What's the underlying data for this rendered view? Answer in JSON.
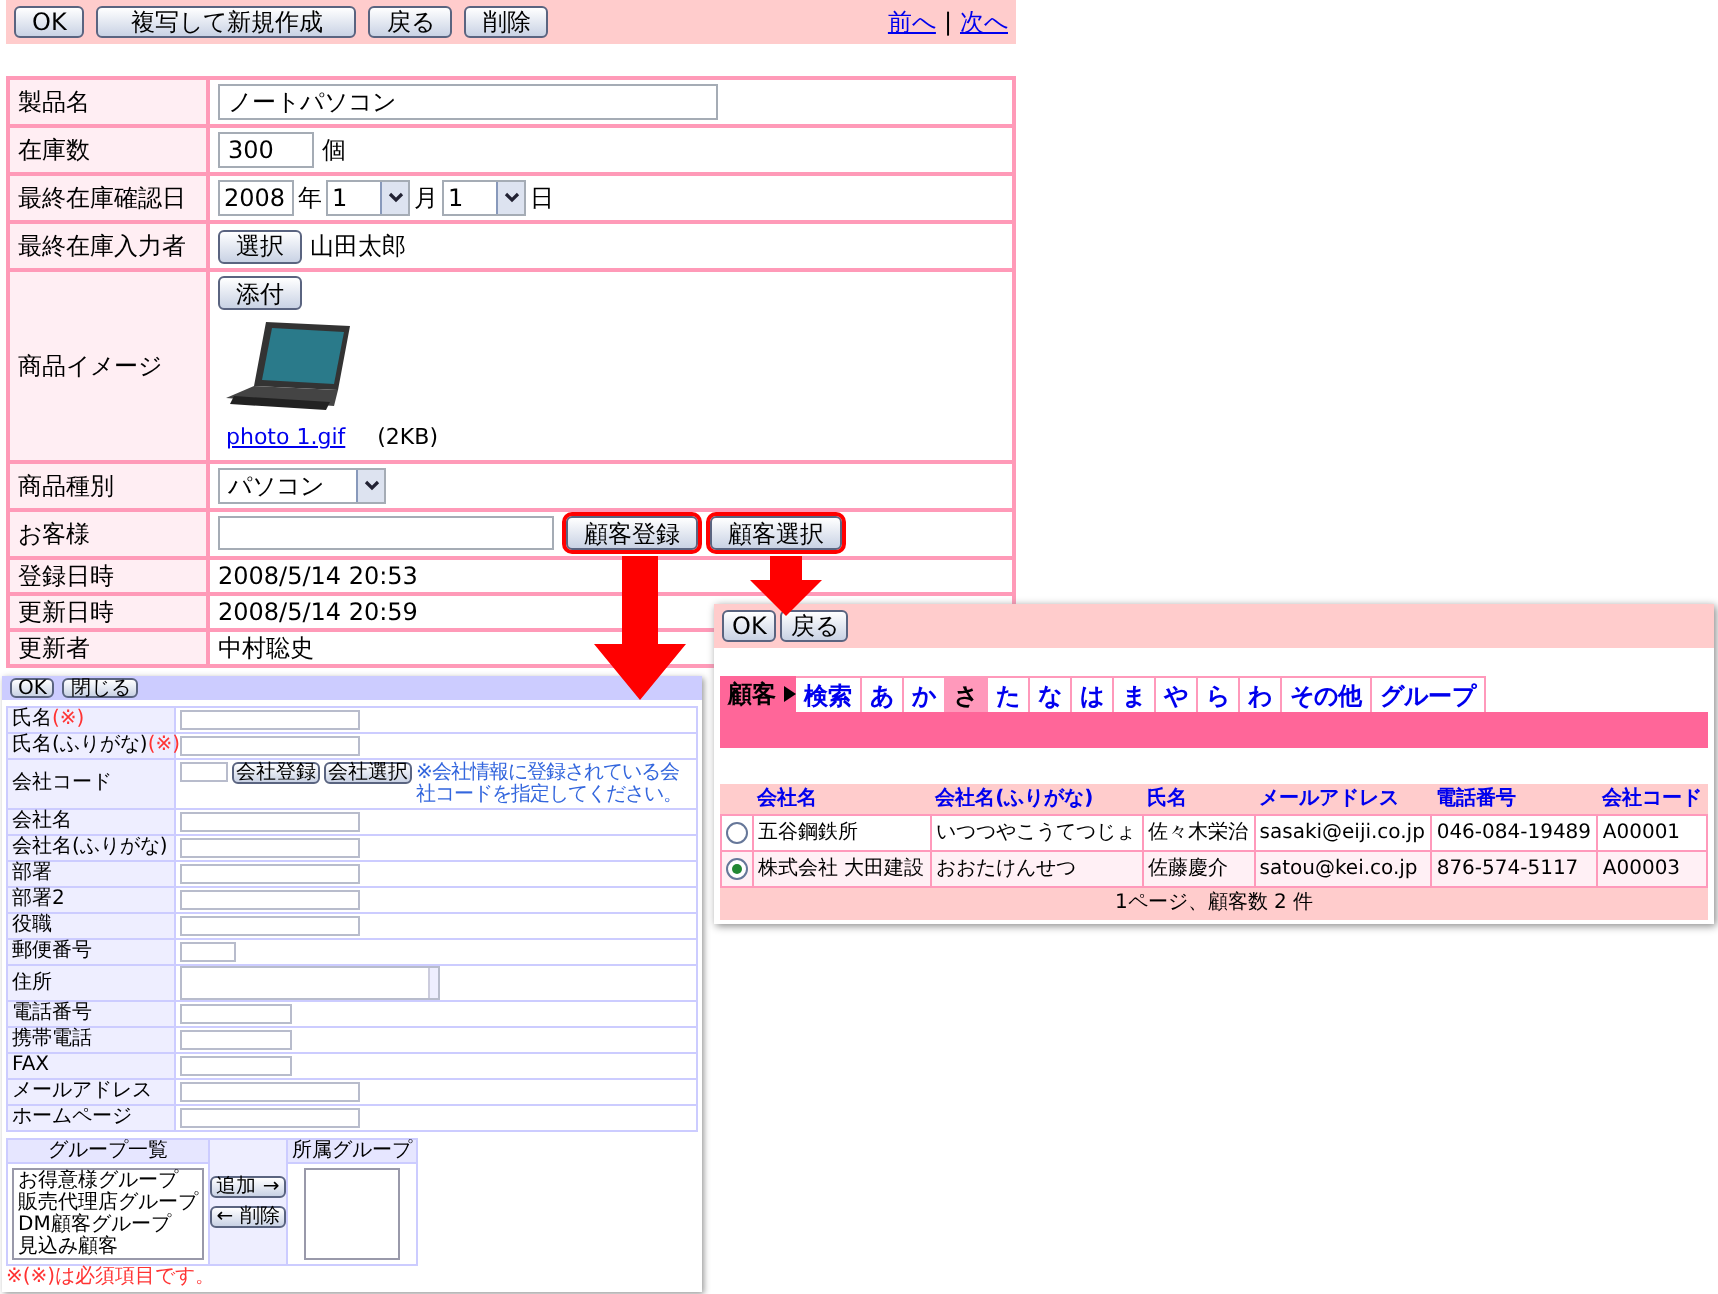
{
  "product_form": {
    "toolbar_buttons": [
      "OK",
      "複写して新規作成",
      "戻る",
      "削除"
    ],
    "nav_links": [
      "前へ",
      "次へ"
    ],
    "nav_separator": "|",
    "rows": [
      {
        "kind": "text",
        "label": "製品名",
        "value": "ノートパソコン"
      },
      {
        "kind": "number",
        "label": "在庫数",
        "value": "300",
        "unit": "個"
      },
      {
        "kind": "date",
        "label": "最終在庫確認日",
        "year": "2008",
        "year_unit": "年",
        "month": "1",
        "month_unit": "月",
        "day": "1",
        "day_unit": "日"
      },
      {
        "kind": "picker",
        "label": "最終在庫入力者",
        "button": "選択",
        "value": "山田太郎"
      },
      {
        "kind": "image",
        "label": "商品イメージ",
        "button": "添付",
        "file_name": "photo 1.gif",
        "file_size": "(2KB)"
      },
      {
        "kind": "select",
        "label": "商品種別",
        "value": "パソコン"
      },
      {
        "kind": "customer",
        "label": "お客様",
        "buttons": [
          {
            "label": "顧客登録",
            "highlighted": true
          },
          {
            "label": "顧客選択",
            "highlighted": true
          }
        ]
      },
      {
        "kind": "static",
        "label": "登録日時",
        "value": "2008/5/14 20:53"
      },
      {
        "kind": "static",
        "label": "更新日時",
        "value": "2008/5/14 20:59"
      },
      {
        "kind": "static",
        "label": "更新者",
        "value": "中村聡史"
      }
    ]
  },
  "customer_register_form": {
    "toolbar_buttons": [
      "OK",
      "閉じる"
    ],
    "rows": [
      {
        "kind": "long_text",
        "label": "氏名",
        "required_mark": "(※)"
      },
      {
        "kind": "long_text",
        "label": "氏名(ふりがな)",
        "required_mark": "(※)"
      },
      {
        "kind": "code",
        "label": "会社コード",
        "buttons": [
          "会社登録",
          "会社選択"
        ],
        "note": "※会社情報に登録されている会社コードを指定してください。"
      },
      {
        "kind": "long_text",
        "label": "会社名"
      },
      {
        "kind": "long_text",
        "label": "会社名(ふりがな)"
      },
      {
        "kind": "long_text",
        "label": "部署"
      },
      {
        "kind": "long_text",
        "label": "部署2"
      },
      {
        "kind": "long_text",
        "label": "役職"
      },
      {
        "kind": "short_text",
        "label": "郵便番号"
      },
      {
        "kind": "textarea",
        "label": "住所"
      },
      {
        "kind": "medium_text",
        "label": "電話番号"
      },
      {
        "kind": "medium_text",
        "label": "携帯電話"
      },
      {
        "kind": "medium_text",
        "label": "FAX"
      },
      {
        "kind": "long_text",
        "label": "メールアドレス"
      },
      {
        "kind": "long_text",
        "label": "ホームページ"
      }
    ],
    "groups": {
      "available_title": "グループ一覧",
      "available": [
        "お得意様グループ",
        "販売代理店グループ",
        "DM顧客グループ",
        "見込み顧客"
      ],
      "member_title": "所属グループ",
      "add_button": "追加 →",
      "remove_button": "← 削除"
    },
    "required_note": "※(※)は必須項目です。"
  },
  "customer_select": {
    "toolbar_buttons": [
      "OK",
      "戻る"
    ],
    "tab_heading": "顧客",
    "tabs": [
      {
        "label": "検索",
        "selected": false
      },
      {
        "label": "あ",
        "selected": false
      },
      {
        "label": "か",
        "selected": false
      },
      {
        "label": "さ",
        "selected": true
      },
      {
        "label": "た",
        "selected": false
      },
      {
        "label": "な",
        "selected": false
      },
      {
        "label": "は",
        "selected": false
      },
      {
        "label": "ま",
        "selected": false
      },
      {
        "label": "や",
        "selected": false
      },
      {
        "label": "ら",
        "selected": false
      },
      {
        "label": "わ",
        "selected": false
      },
      {
        "label": "その他",
        "selected": false
      },
      {
        "label": "グループ",
        "selected": false
      }
    ],
    "columns": [
      "会社名",
      "会社名(ふりがな)",
      "氏名",
      "メールアドレス",
      "電話番号",
      "会社コード"
    ],
    "rows": [
      {
        "selected": false,
        "cells": [
          "五谷鋼鉄所",
          "いつつやこうてつじょ",
          "佐々木栄治",
          "sasaki@eiji.co.jp",
          "046-084-19489",
          "A00001"
        ]
      },
      {
        "selected": true,
        "cells": [
          "株式会社 大田建設",
          "おおたけんせつ",
          "佐藤慶介",
          "satou@kei.co.jp",
          "876-574-5117",
          "A00003"
        ]
      }
    ],
    "footer": "1ページ、顧客数 2 件"
  }
}
